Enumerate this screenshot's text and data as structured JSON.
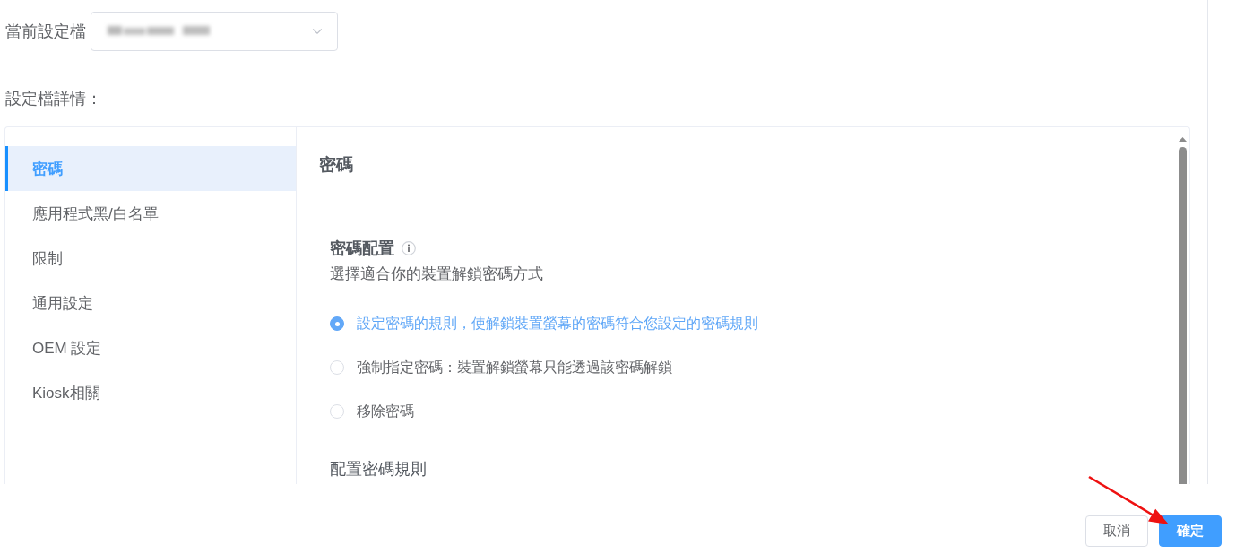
{
  "profile_selector": {
    "label": "當前設定檔"
  },
  "details": {
    "label": "設定檔詳情："
  },
  "sidebar": {
    "items": [
      {
        "label": "密碼",
        "selected": true
      },
      {
        "label": "應用程式黑/白名單",
        "selected": false
      },
      {
        "label": "限制",
        "selected": false
      },
      {
        "label": "通用設定",
        "selected": false
      },
      {
        "label": "OEM 設定",
        "selected": false
      },
      {
        "label": "Kiosk相關",
        "selected": false
      }
    ]
  },
  "content": {
    "title": "密碼",
    "password_config": {
      "title": "密碼配置",
      "description": "選擇適合你的裝置解鎖密碼方式",
      "options": [
        {
          "label": "設定密碼的規則，使解鎖裝置螢幕的密碼符合您設定的密碼規則",
          "selected": true
        },
        {
          "label": "強制指定密碼：裝置解鎖螢幕只能透過該密碼解鎖",
          "selected": false
        },
        {
          "label": "移除密碼",
          "selected": false
        }
      ]
    },
    "rules_section": {
      "title": "配置密碼規則"
    }
  },
  "buttons": [
    {
      "label": "取消",
      "kind": "secondary"
    },
    {
      "label": "確定",
      "kind": "primary"
    }
  ]
}
